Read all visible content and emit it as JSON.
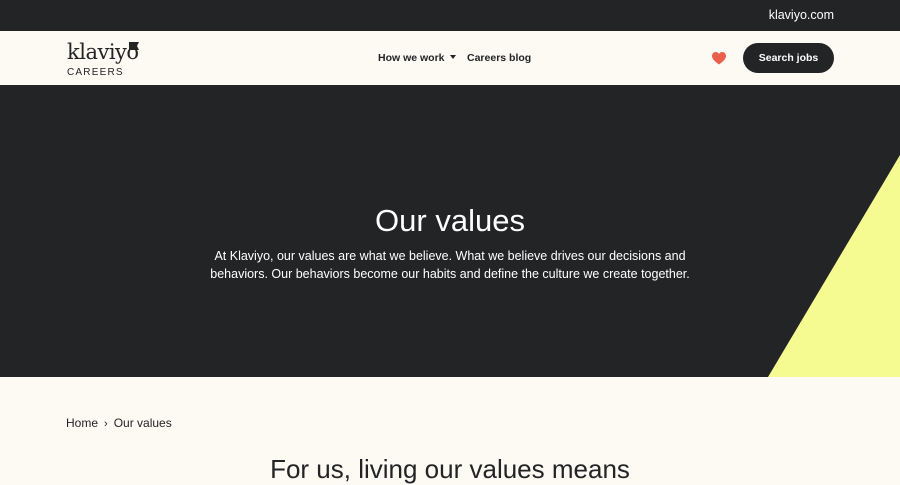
{
  "topbar": {
    "link": "klaviyo.com"
  },
  "brand": {
    "wordmark": "klaviyo",
    "subtitle": "CAREERS"
  },
  "nav": {
    "how_we_work": "How we work",
    "careers_blog": "Careers blog",
    "search_jobs": "Search jobs"
  },
  "hero": {
    "title": "Our values",
    "description": "At Klaviyo, our values are what we believe. What we believe drives our decisions and behaviors. Our behaviors become our habits and define the culture we create together."
  },
  "breadcrumb": {
    "home": "Home",
    "separator": "›",
    "current": "Our values"
  },
  "section": {
    "title": "For us, living our values means"
  },
  "colors": {
    "dark": "#232426",
    "cream": "#fdf9f3",
    "accent_yellow": "#f5fb91",
    "heart": "#e8604c"
  },
  "icons": {
    "heart": "heart-icon",
    "caret": "caret-down-icon",
    "flag": "flag-icon"
  }
}
